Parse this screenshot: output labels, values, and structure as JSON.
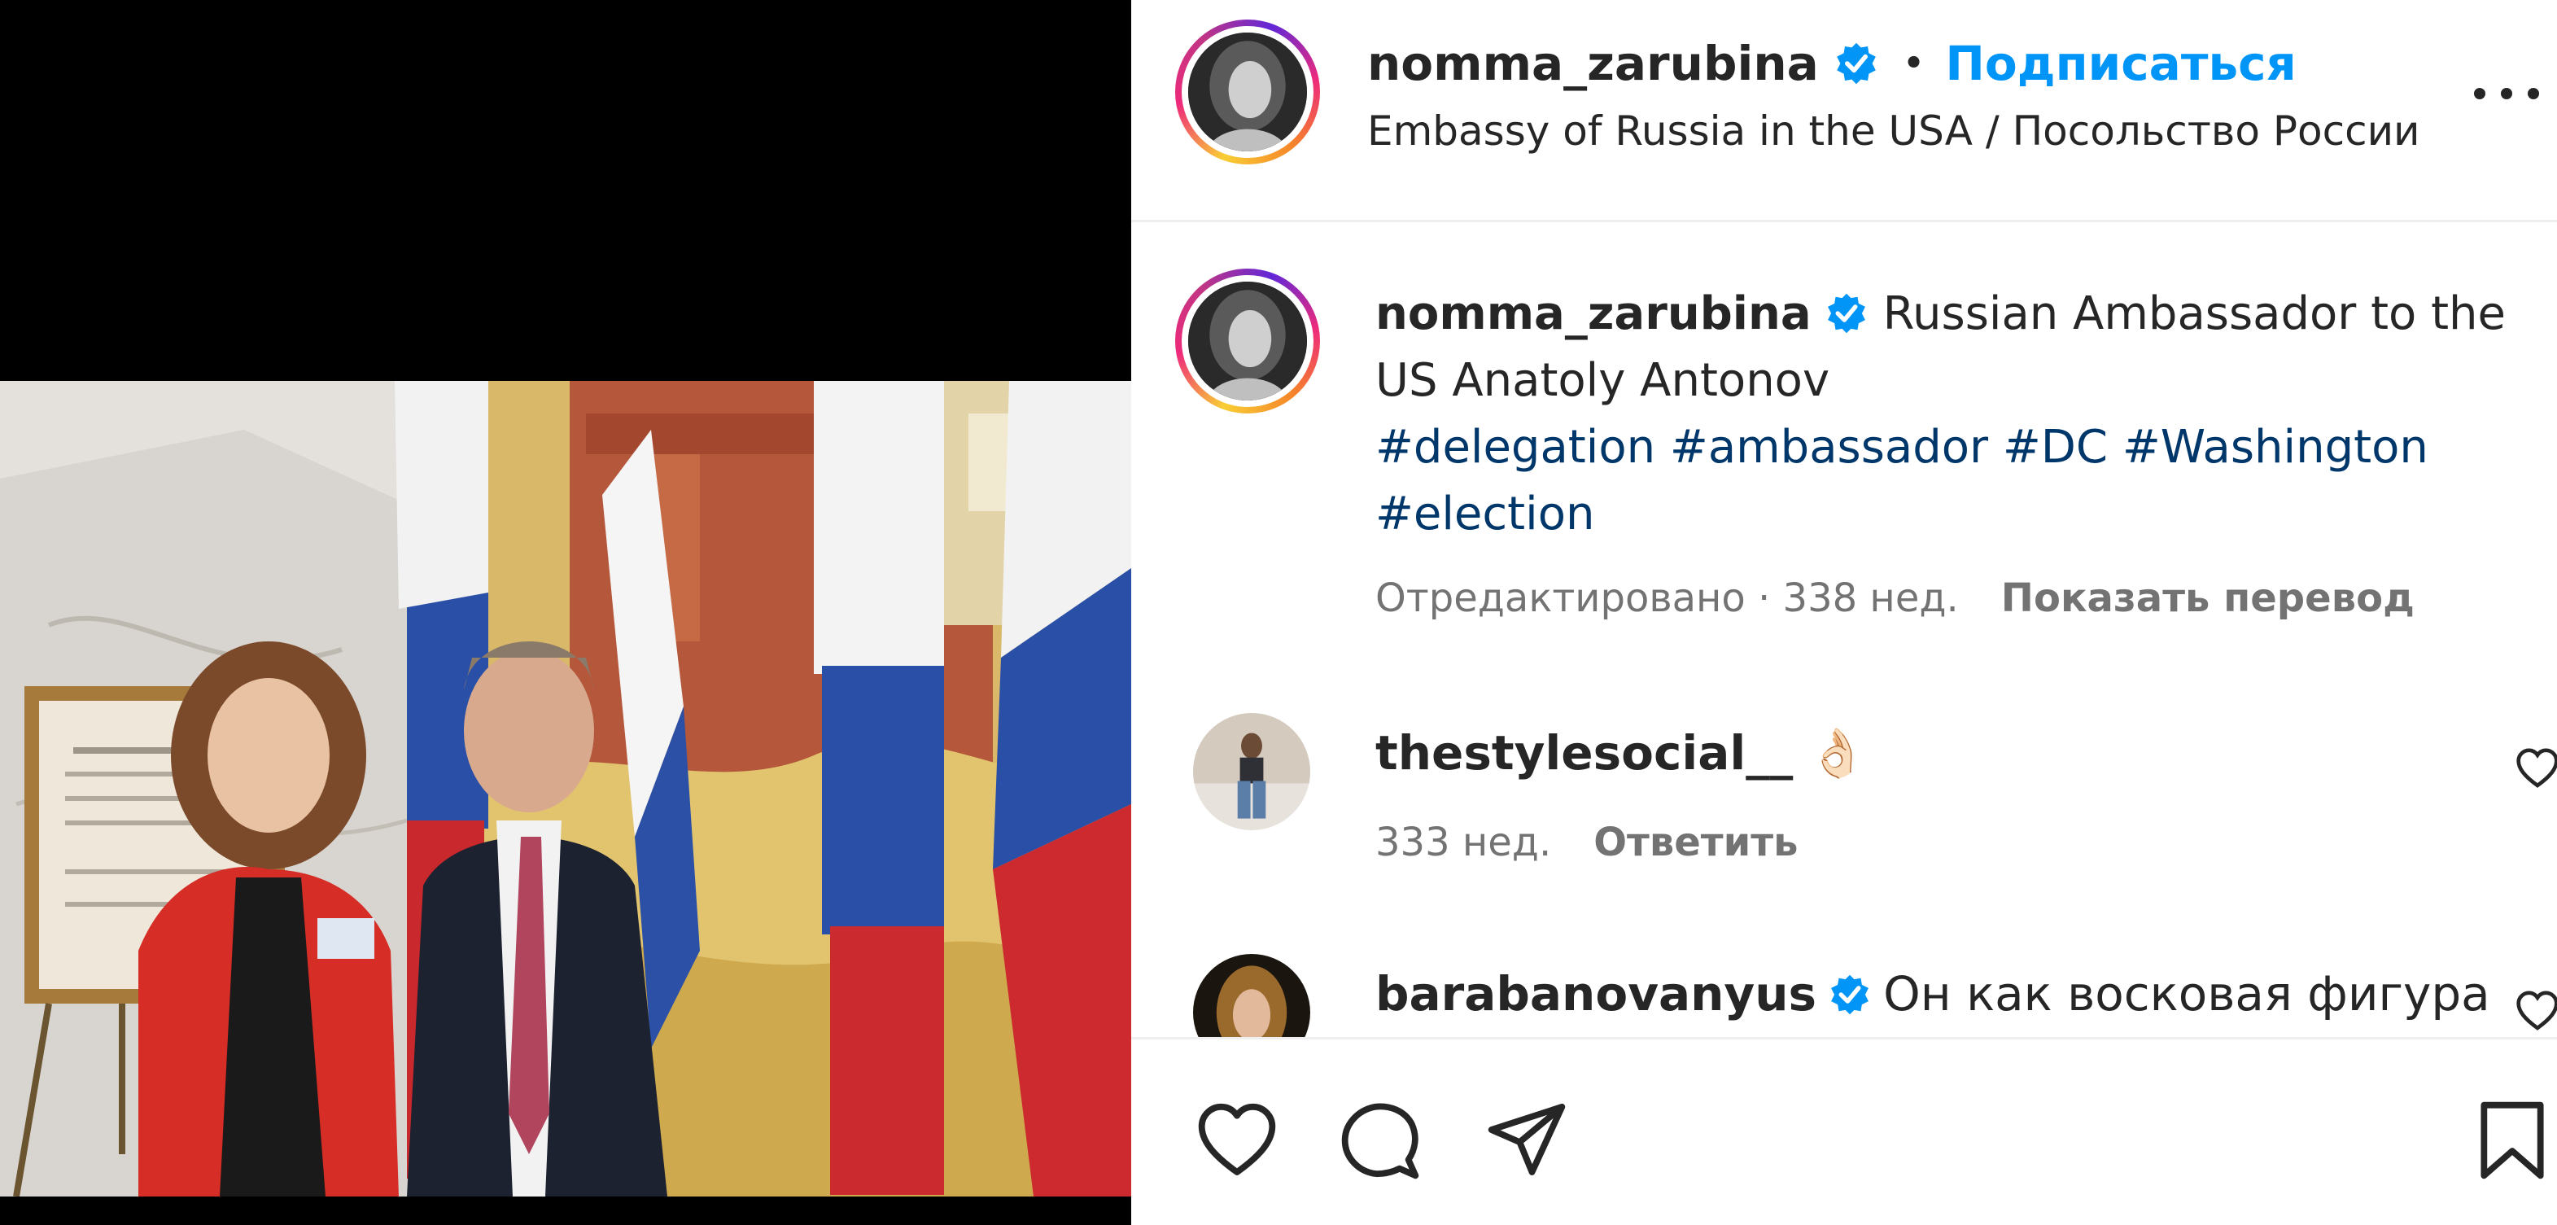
{
  "post": {
    "media_alt": "Photo: woman in red jacket and man in dark suit in front of Russian flags and a painting of the Kremlin",
    "author": {
      "username": "nomma_zarubina",
      "verified": true
    },
    "follow_label": "Подписаться",
    "separator": "•",
    "location": "Embassy of Russia in the USA / Посольство России в (",
    "more_icon": "more-horizontal-icon"
  },
  "caption": {
    "username": "nomma_zarubina",
    "text": "Russian Ambassador to the US Anatoly Antonov",
    "hashtags": [
      "#delegation",
      "#ambassador",
      "#DC",
      "#Washington",
      "#election"
    ],
    "edited_time": "Отредактировано · 338 нед.",
    "translate_label": "Показать перевод"
  },
  "comments": [
    {
      "username": "thestylesocial__",
      "text": "👌🏻",
      "time": "333 нед.",
      "reply_label": "Ответить",
      "verified": false
    },
    {
      "username": "barabanovanyus",
      "text": "Он как восковая фигура",
      "verified": true
    }
  ],
  "actions": {
    "like_icon": "heart-icon",
    "comment_icon": "comment-icon",
    "share_icon": "send-icon",
    "save_icon": "bookmark-icon"
  },
  "colors": {
    "link_blue": "#0095f6",
    "hashtag_blue": "#00376b",
    "secondary_text": "#737373",
    "verified_blue": "#0095f6"
  }
}
